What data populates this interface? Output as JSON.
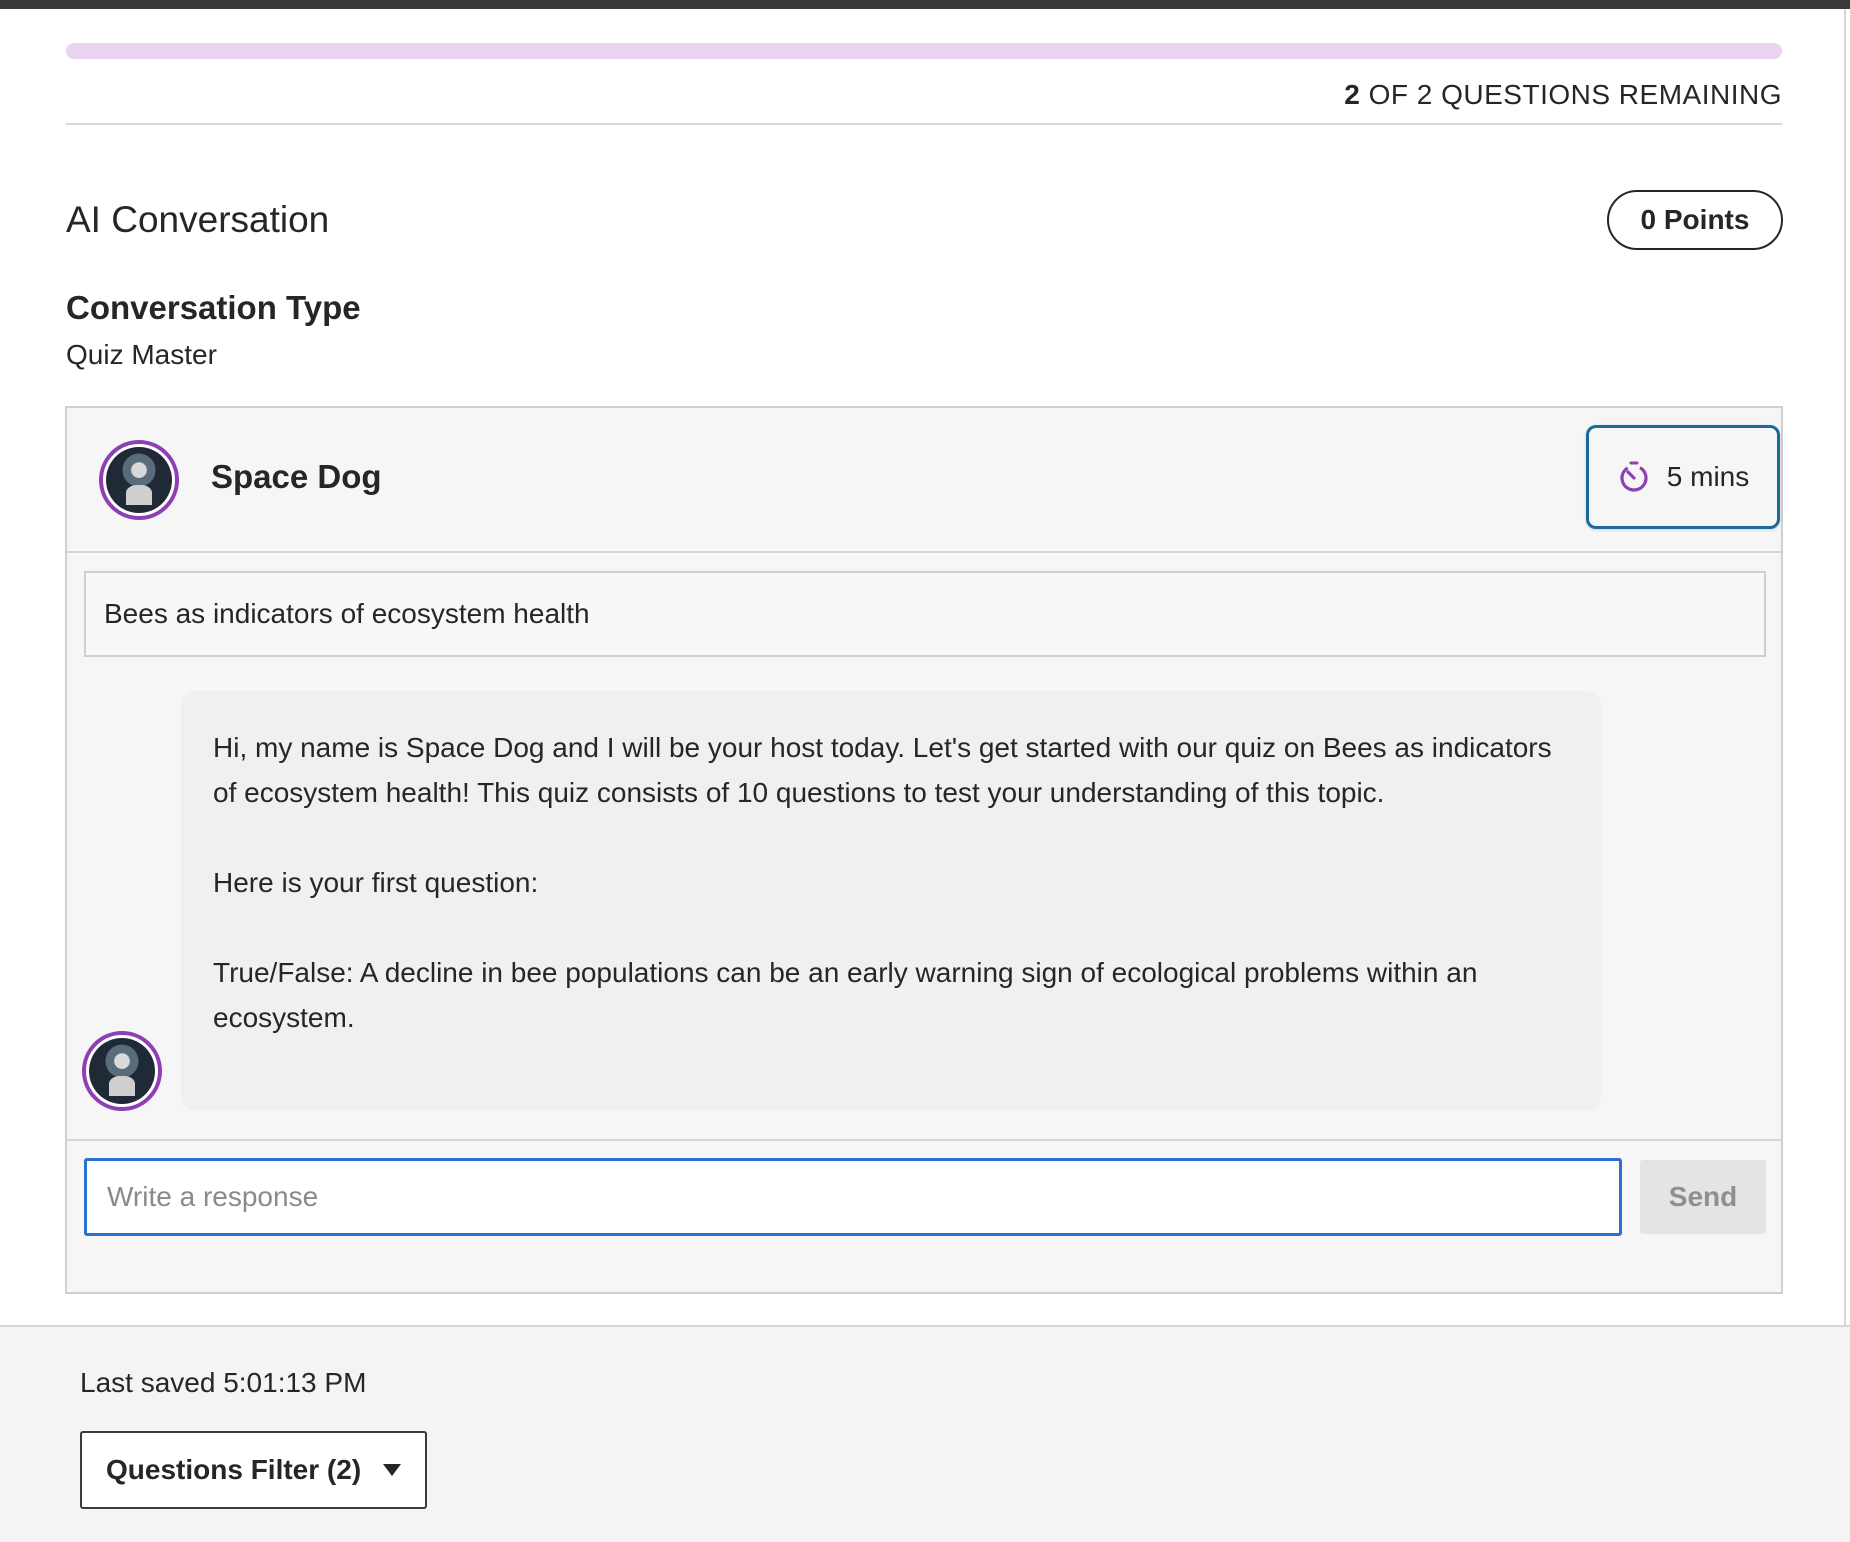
{
  "progress": {
    "fraction_complete": 0,
    "remaining_count": "2",
    "remaining_suffix": " OF 2 QUESTIONS REMAINING",
    "track_color": "#ead3f0"
  },
  "question": {
    "title": "AI Conversation",
    "points_label": "0 Points",
    "conversation_type_label": "Conversation Type",
    "conversation_type_value": "Quiz Master"
  },
  "chat": {
    "host_name": "Space Dog",
    "avatar_icon": "space-dog-avatar",
    "timer_icon": "timer-icon",
    "timer_label": "5 mins",
    "topic": "Bees as indicators of ecosystem health",
    "message_paragraphs": [
      "Hi, my name is Space Dog and I will be your host today. Let's get started with our quiz on Bees as indicators of ecosystem health! This quiz consists of 10 questions to test your understanding of this topic.",
      "Here is your first question:",
      "True/False: A decline in bee populations can be an early warning sign of ecological problems within an ecosystem."
    ],
    "response_placeholder": "Write a response",
    "response_value": "",
    "send_label": "Send",
    "accent_color": "#8e3fb5",
    "focus_color": "#2b6fd0"
  },
  "footer": {
    "last_saved": "Last saved 5:01:13 PM",
    "filter_label": "Questions Filter (2)",
    "filter_icon": "caret-down-icon"
  }
}
